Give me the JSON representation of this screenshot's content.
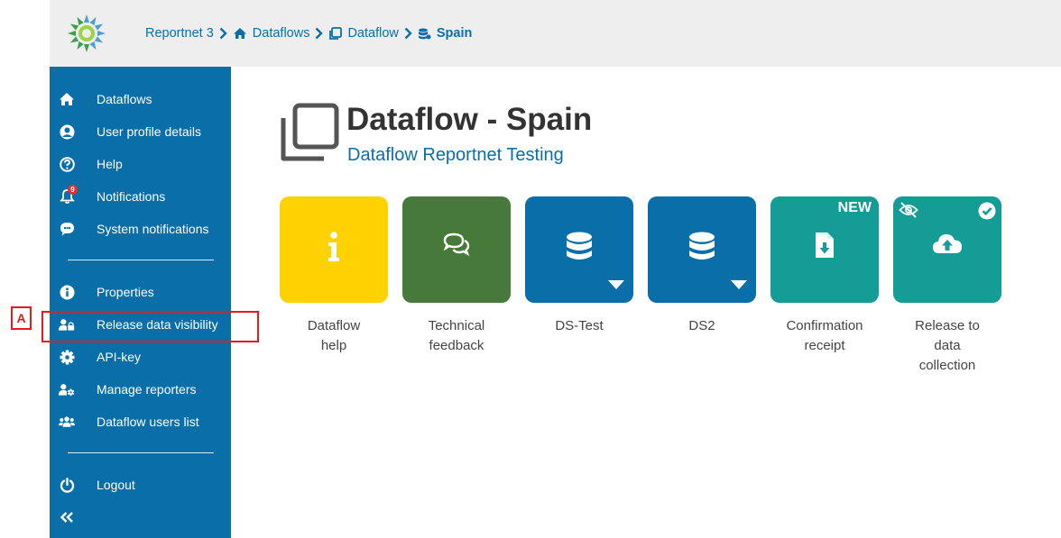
{
  "breadcrumb": {
    "root": "Reportnet 3",
    "dataflows": "Dataflows",
    "dataflow": "Dataflow",
    "current": "Spain"
  },
  "sidebar": {
    "items": [
      {
        "label": "Dataflows",
        "icon": "home-icon"
      },
      {
        "label": "User profile details",
        "icon": "user-circle-icon"
      },
      {
        "label": "Help",
        "icon": "question-circle-icon"
      },
      {
        "label": "Notifications",
        "icon": "bell-icon",
        "badge": "9"
      },
      {
        "label": "System notifications",
        "icon": "comment-icon"
      },
      {
        "label": "Properties",
        "icon": "info-circle-icon"
      },
      {
        "label": "Release data visibility",
        "icon": "user-lock-icon"
      },
      {
        "label": "API-key",
        "icon": "cog-icon"
      },
      {
        "label": "Manage reporters",
        "icon": "user-cog-icon"
      },
      {
        "label": "Dataflow users list",
        "icon": "users-icon"
      },
      {
        "label": "Logout",
        "icon": "power-icon"
      }
    ],
    "collapse_icon": "double-chevron-left-icon"
  },
  "annotation": {
    "label": "A",
    "color": "#e01e1e"
  },
  "main": {
    "title": "Dataflow - Spain",
    "subtitle": "Dataflow Reportnet Testing"
  },
  "tiles": [
    {
      "line1": "Dataflow",
      "line2": "help",
      "line3": "",
      "color": "#ffd200",
      "icon": "info-icon"
    },
    {
      "line1": "Technical",
      "line2": "feedback",
      "line3": "",
      "color": "#477a3a",
      "icon": "comments-icon"
    },
    {
      "line1": "DS-Test",
      "line2": "",
      "line3": "",
      "color": "#0a6ea8",
      "icon": "database-icon"
    },
    {
      "line1": "DS2",
      "line2": "",
      "line3": "",
      "color": "#0a6ea8",
      "icon": "database-icon"
    },
    {
      "line1": "Confirmation",
      "line2": "receipt",
      "line3": "",
      "color": "#149c96",
      "icon": "file-download-icon",
      "tag": "NEW"
    },
    {
      "line1": "Release to",
      "line2": "data",
      "line3": "collection",
      "color": "#149c96",
      "icon": "cloud-upload-icon"
    }
  ],
  "colors": {
    "primary": "#0a6ea8",
    "header_bg": "#eeeeee",
    "text_dark": "#333333"
  }
}
